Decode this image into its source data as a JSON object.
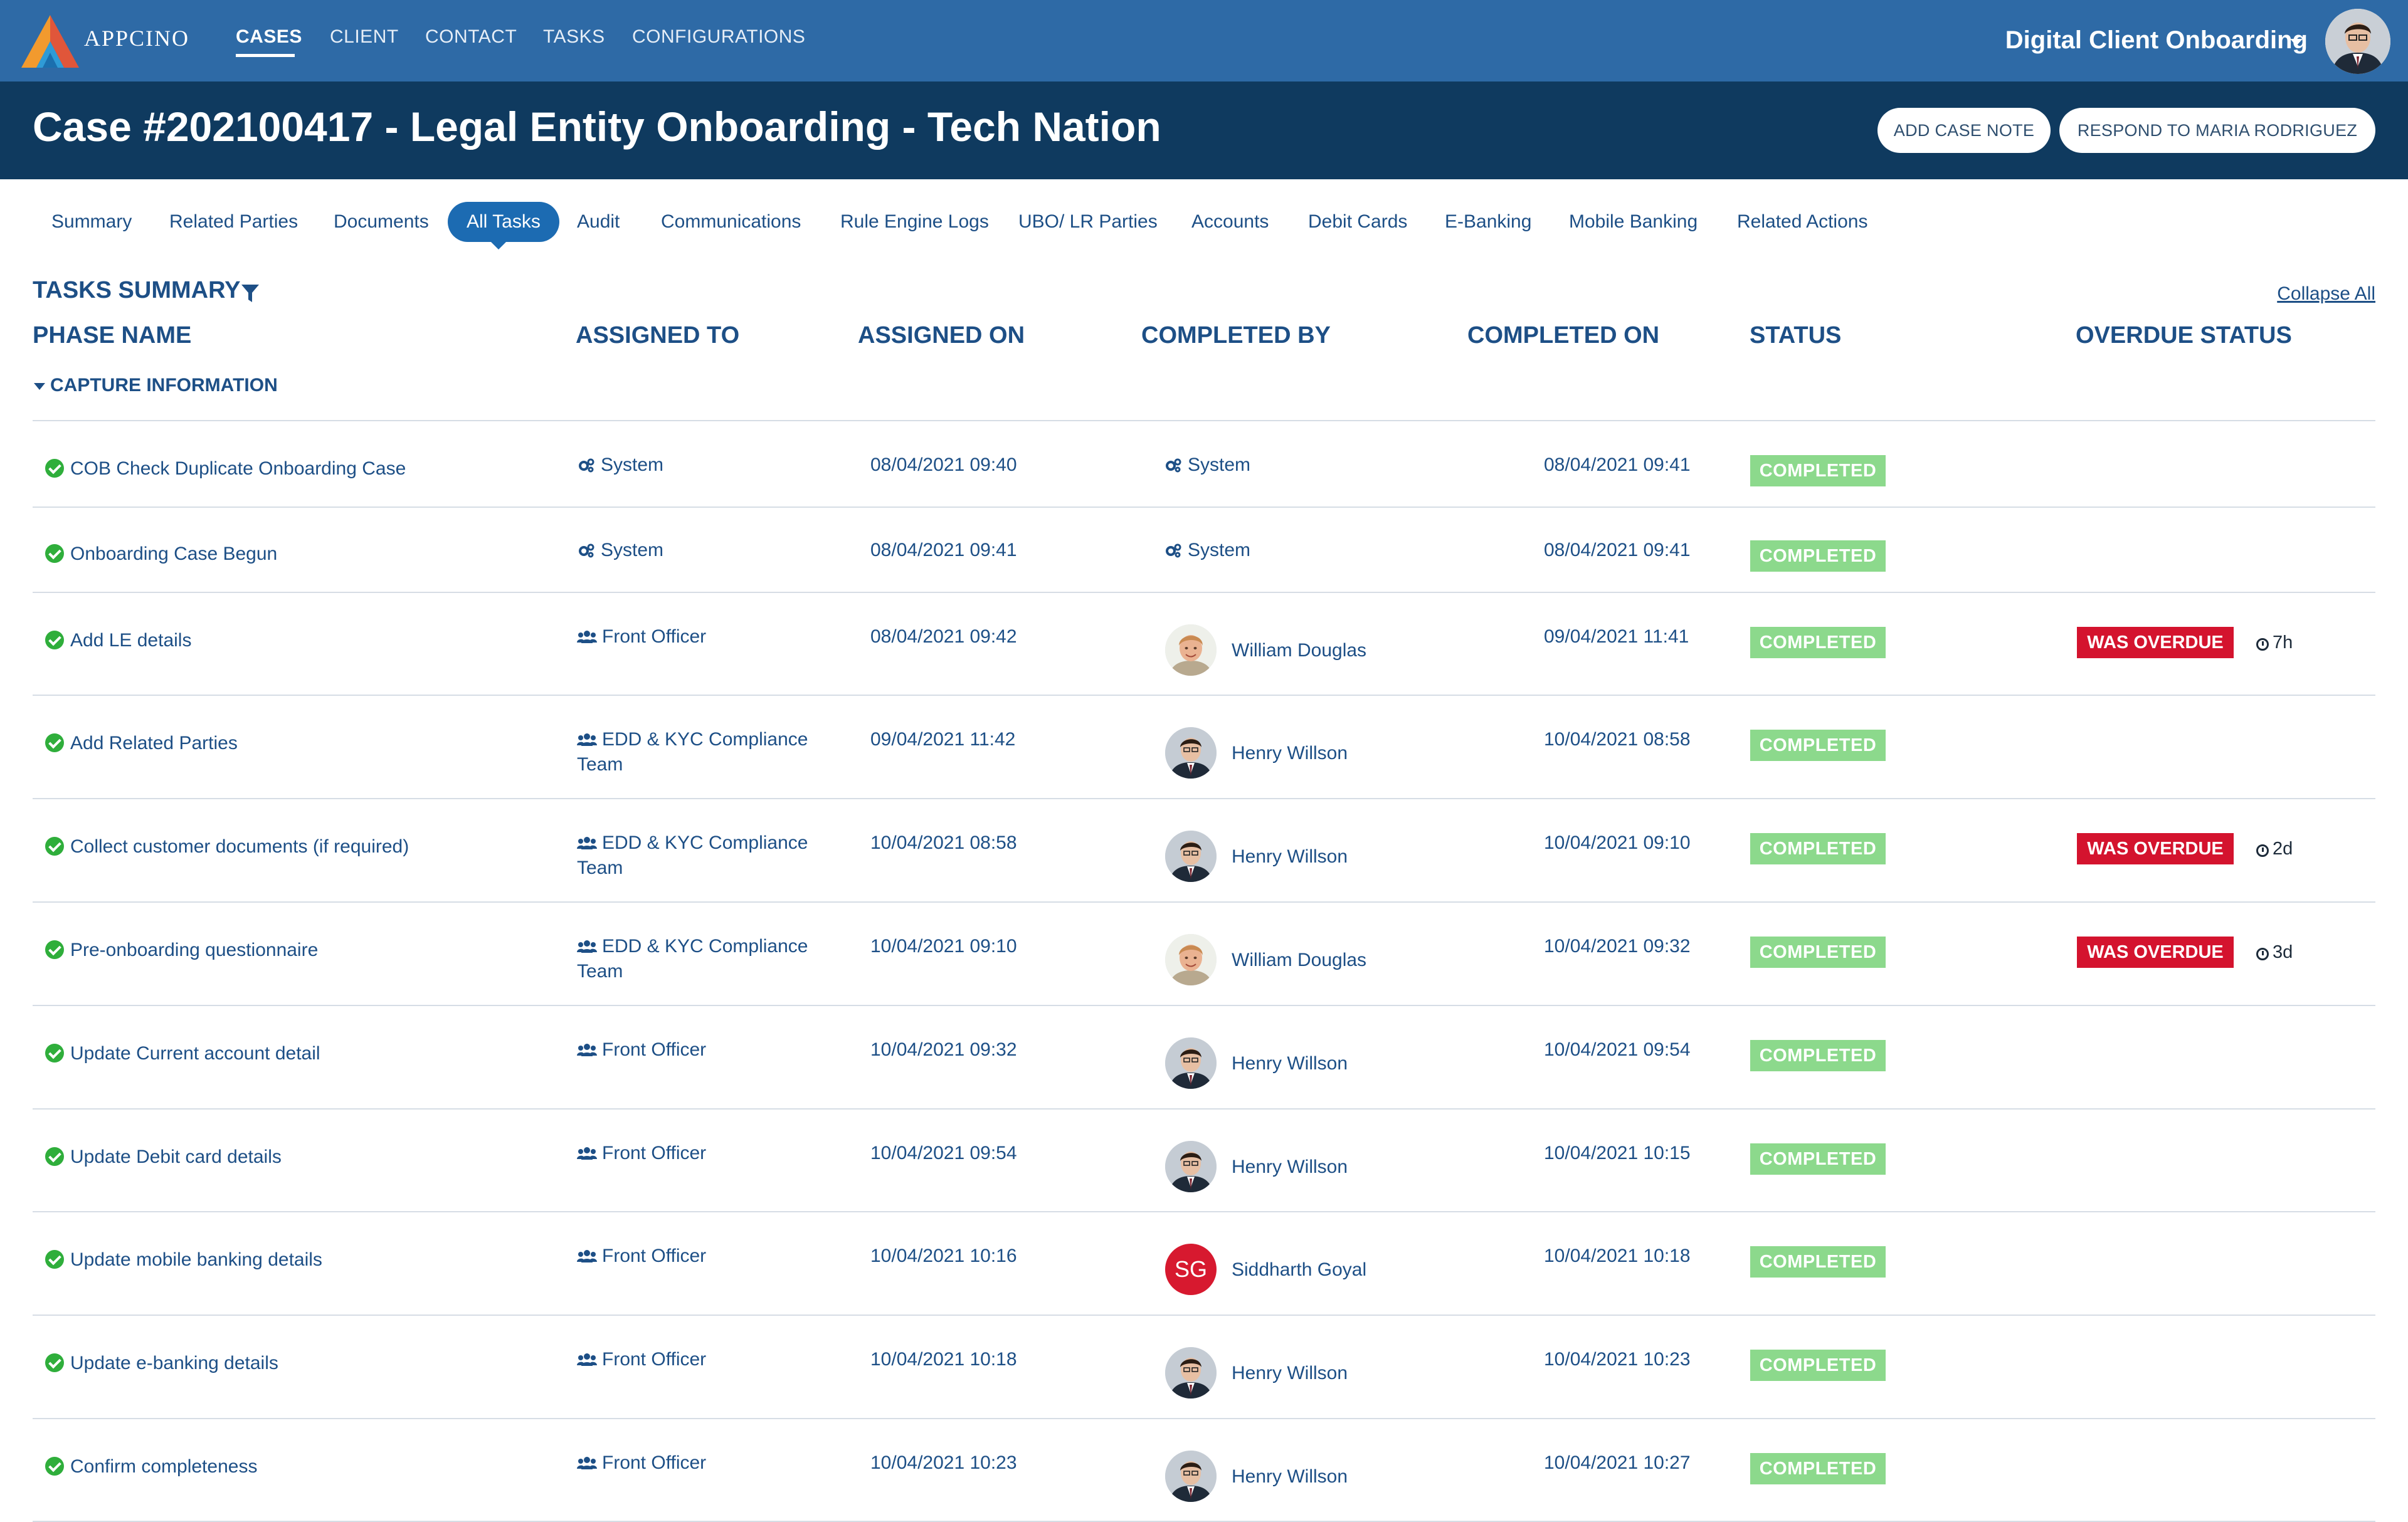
{
  "brand": {
    "name": "APPCINO"
  },
  "nav": {
    "items": [
      "CASES",
      "CLIENT",
      "CONTACT",
      "TASKS",
      "CONFIGURATIONS"
    ],
    "active": "CASES",
    "app_switcher": "Digital Client Onboarding"
  },
  "case": {
    "title": "Case #202100417 - Legal Entity Onboarding - Tech Nation",
    "buttons": [
      "ADD CASE NOTE",
      "RESPOND TO MARIA RODRIGUEZ"
    ]
  },
  "tabs": [
    "Summary",
    "Related Parties",
    "Documents",
    "All Tasks",
    "Audit",
    "Communications",
    "Rule Engine Logs",
    "UBO/ LR Parties",
    "Accounts",
    "Debit Cards",
    "E-Banking",
    "Mobile Banking",
    "Related Actions"
  ],
  "active_tab": "All Tasks",
  "summary": {
    "title": "TASKS SUMMARY",
    "collapse_all": "Collapse All",
    "columns": [
      "PHASE NAME",
      "ASSIGNED TO",
      "ASSIGNED ON",
      "COMPLETED BY",
      "COMPLETED ON",
      "STATUS",
      "OVERDUE STATUS"
    ],
    "phase": "CAPTURE INFORMATION"
  },
  "colors": {
    "nav": "#2e6aa6",
    "header": "#0f3a5f",
    "completed": "#8cd98c",
    "overdue": "#d4132e",
    "text": "#1d4f86"
  },
  "tasks": [
    {
      "name": "COB Check Duplicate Onboarding Case",
      "assigned_to": "System",
      "assigned_icon": "gears-icon",
      "assigned_on": "08/04/2021 09:40",
      "completed_by": "System",
      "completed_on": "08/04/2021 09:41",
      "status": "COMPLETED",
      "overdue": "",
      "overdue_time": ""
    },
    {
      "name": "Onboarding Case Begun",
      "assigned_to": "System",
      "assigned_icon": "gears-icon",
      "assigned_on": "08/04/2021 09:41",
      "completed_by": "System",
      "completed_on": "08/04/2021 09:41",
      "status": "COMPLETED",
      "overdue": "",
      "overdue_time": ""
    },
    {
      "name": "Add LE details",
      "assigned_to": "Front Officer",
      "assigned_icon": "users-icon",
      "assigned_on": "08/04/2021 09:42",
      "completed_by": "William Douglas",
      "completed_on": "09/04/2021 11:41",
      "status": "COMPLETED",
      "overdue": "WAS OVERDUE",
      "overdue_time": "7h"
    },
    {
      "name": "Add Related Parties",
      "assigned_to": "EDD & KYC Compliance Team",
      "assigned_icon": "users-icon",
      "assigned_on": "09/04/2021 11:42",
      "completed_by": "Henry Willson",
      "completed_on": "10/04/2021 08:58",
      "status": "COMPLETED",
      "overdue": "",
      "overdue_time": ""
    },
    {
      "name": "Collect customer documents (if required)",
      "assigned_to": "EDD & KYC Compliance Team",
      "assigned_icon": "users-icon",
      "assigned_on": "10/04/2021 08:58",
      "completed_by": "Henry Willson",
      "completed_on": "10/04/2021 09:10",
      "status": "COMPLETED",
      "overdue": "WAS OVERDUE",
      "overdue_time": "2d"
    },
    {
      "name": "Pre-onboarding questionnaire",
      "assigned_to": "EDD & KYC Compliance Team",
      "assigned_icon": "users-icon",
      "assigned_on": "10/04/2021 09:10",
      "completed_by": "William Douglas",
      "completed_on": "10/04/2021 09:32",
      "status": "COMPLETED",
      "overdue": "WAS OVERDUE",
      "overdue_time": "3d"
    },
    {
      "name": "Update Current account detail",
      "assigned_to": "Front Officer",
      "assigned_icon": "users-icon",
      "assigned_on": "10/04/2021 09:32",
      "completed_by": "Henry Willson",
      "completed_on": "10/04/2021 09:54",
      "status": "COMPLETED",
      "overdue": "",
      "overdue_time": ""
    },
    {
      "name": "Update Debit card details",
      "assigned_to": "Front Officer",
      "assigned_icon": "users-icon",
      "assigned_on": "10/04/2021 09:54",
      "completed_by": "Henry Willson",
      "completed_on": "10/04/2021 10:15",
      "status": "COMPLETED",
      "overdue": "",
      "overdue_time": ""
    },
    {
      "name": "Update mobile banking details",
      "assigned_to": "Front Officer",
      "assigned_icon": "users-icon",
      "assigned_on": "10/04/2021 10:16",
      "completed_by": "Siddharth Goyal",
      "completed_by_initials": "SG",
      "completed_on": "10/04/2021 10:18",
      "status": "COMPLETED",
      "overdue": "",
      "overdue_time": ""
    },
    {
      "name": "Update e-banking details",
      "assigned_to": "Front Officer",
      "assigned_icon": "users-icon",
      "assigned_on": "10/04/2021 10:18",
      "completed_by": "Henry Willson",
      "completed_on": "10/04/2021 10:23",
      "status": "COMPLETED",
      "overdue": "",
      "overdue_time": ""
    },
    {
      "name": "Confirm completeness",
      "assigned_to": "Front Officer",
      "assigned_icon": "users-icon",
      "assigned_on": "10/04/2021 10:23",
      "completed_by": "Henry Willson",
      "completed_on": "10/04/2021 10:27",
      "status": "COMPLETED",
      "overdue": "",
      "overdue_time": ""
    }
  ]
}
